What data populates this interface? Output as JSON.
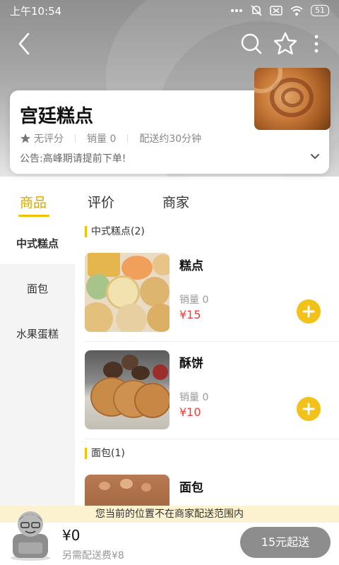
{
  "status_bar": {
    "time": "上午10:54",
    "battery": "51"
  },
  "nav": {
    "back_icon": "back-chevron-icon",
    "search_icon": "search-icon",
    "star_icon": "star-outline-icon",
    "more_icon": "more-vertical-icon"
  },
  "shop": {
    "name": "宫廷糕点",
    "rating": "无评分",
    "sales": "销量 0",
    "delivery": "配送约30分钟",
    "notice": "公告:高峰期请提前下单!"
  },
  "tabs": [
    {
      "label": "商品",
      "active": true
    },
    {
      "label": "评价",
      "active": false
    },
    {
      "label": "商家",
      "active": false
    }
  ],
  "sidebar": {
    "items": [
      {
        "label": "中式糕点",
        "active": true
      },
      {
        "label": "面包",
        "active": false
      },
      {
        "label": "水果蛋糕",
        "active": false
      }
    ]
  },
  "sections": [
    {
      "title": "中式糕点(2)",
      "products": [
        {
          "name": "糕点",
          "sales": "销量 0",
          "price": "¥15"
        },
        {
          "name": "酥饼",
          "sales": "销量 0",
          "price": "¥10"
        }
      ]
    },
    {
      "title": "面包(1)",
      "products": [
        {
          "name": "面包"
        }
      ]
    }
  ],
  "bottom": {
    "range_notice": "您当前的位置不在商家配送范围内",
    "total": "¥0",
    "delivery_fee": "另需配送费¥8",
    "min_order": "15元起送"
  },
  "colors": {
    "accent": "#f2c200",
    "price": "#e8413c",
    "disabled_button": "#8d8d8d"
  }
}
